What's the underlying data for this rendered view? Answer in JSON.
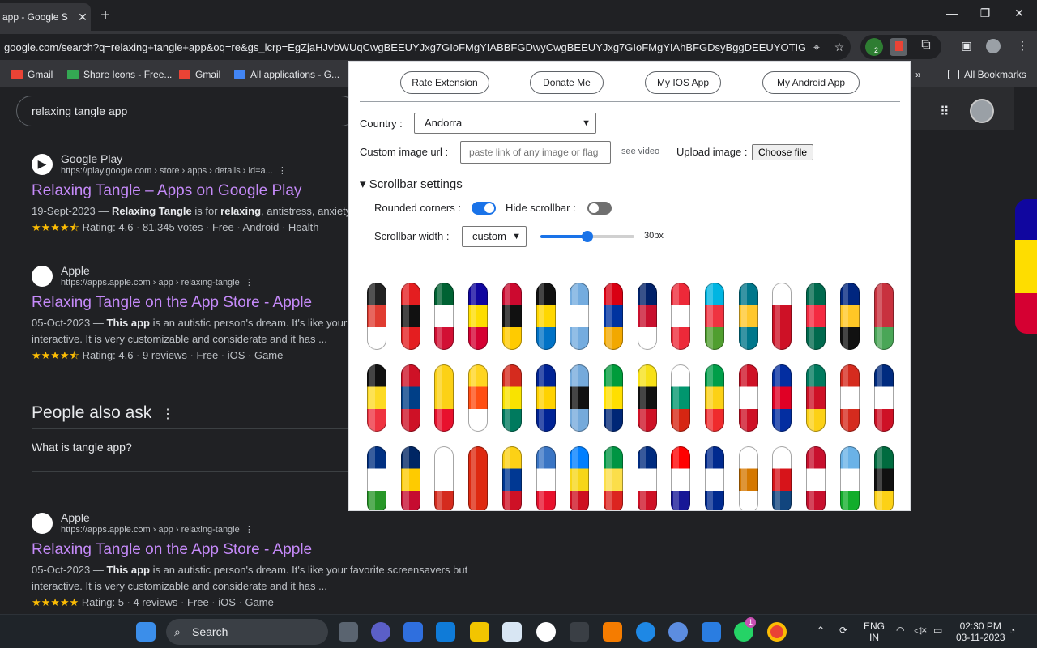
{
  "browser": {
    "tab_title": "app - Google S",
    "tab_close": "✕",
    "new_tab": "+",
    "url": "google.com/search?q=relaxing+tangle+app&oq=re&gs_lcrp=EgZjaHJvbWUqCwgBEEUYJxg7GIoFMgYIABBFGDwyCwgBEEUYJxg7GIoFMgYIAhBFGDsyBggDEEUYOTIGCAQ...",
    "window_controls": [
      "—",
      "❐",
      "✕"
    ],
    "ext_badge": "2",
    "bookmarks": [
      {
        "label": "Gmail",
        "color": "#ea4335"
      },
      {
        "label": "Share Icons - Free...",
        "color": "#34a853"
      },
      {
        "label": "Gmail",
        "color": "#ea4335"
      },
      {
        "label": "All applications - G...",
        "color": "#4285f4"
      }
    ],
    "bookmarks_overflow": "»",
    "all_bookmarks": "All Bookmarks"
  },
  "google": {
    "query": "relaxing tangle app",
    "results": [
      {
        "site": "Google Play",
        "url": "https://play.google.com › store › apps › details › id=a...",
        "title": "Relaxing Tangle – Apps on Google Play",
        "snippet_date": "19-Sept-2023 — ",
        "snippet_b1": "Relaxing Tangle",
        "snippet_mid": " is for ",
        "snippet_b2": "relaxing",
        "snippet_end": ", antistress, anxiety",
        "stars": "★★★★⯪",
        "rating": "Rating: 4.6 · 81,345 votes · Free · Android · Health"
      },
      {
        "site": "Apple",
        "url": "https://apps.apple.com › app › relaxing-tangle",
        "title": "Relaxing Tangle on the App Store - Apple",
        "snippet_date": "05-Oct-2023 — ",
        "snippet_b1": "This app",
        "snippet_mid": " is an autistic person's dream. It's like your",
        "line2": "interactive. It is very customizable and considerate and it has ...",
        "stars": "★★★★⯪",
        "rating": "Rating: 4.6 · 9 reviews · Free · iOS · Game"
      },
      {
        "site": "Apple",
        "url": "https://apps.apple.com › app › relaxing-tangle",
        "title": "Relaxing Tangle on the App Store - Apple",
        "snippet_date": "05-Oct-2023 — ",
        "snippet_b1": "This app",
        "snippet_mid": " is an autistic person's dream. It's like your favorite screensavers but",
        "line2": "interactive. It is very customizable and considerate and it has ...",
        "stars": "★★★★★",
        "rating": "Rating: 5 · 4 reviews · Free · iOS · Game"
      }
    ],
    "people_also_ask": "People also ask",
    "paa_question": "What is tangle app?"
  },
  "popup": {
    "buttons": [
      "Rate Extension",
      "Donate Me",
      "My IOS App",
      "My Android App"
    ],
    "country_label": "Country :",
    "country_value": "Andorra",
    "custom_url_label": "Custom image url :",
    "custom_url_placeholder": "paste link of any image or flag",
    "see_video": "see video",
    "upload_label": "Upload image :",
    "choose_file": "Choose file",
    "scrollbar_settings": "▾ Scrollbar settings",
    "rounded_corners_label": "Rounded corners :",
    "rounded_corners_on": true,
    "hide_scrollbar_label": "Hide scrollbar :",
    "hide_scrollbar_on": false,
    "width_label": "Scrollbar width :",
    "width_select": "custom",
    "width_value": "30px",
    "width_fraction": 0.5,
    "toggle_on_color": "#1a73e8",
    "toggle_off_color": "#6f6f6f",
    "flags": [
      [
        "#222222",
        "#e03c31",
        "#ffffff"
      ],
      [
        "#e41e20",
        "#111111",
        "#e41e20"
      ],
      [
        "#006233",
        "#ffffff",
        "#d21034"
      ],
      [
        "#10069f",
        "#fedd00",
        "#d50032"
      ],
      [
        "#cc092f",
        "#111111",
        "#ffcb00"
      ],
      [
        "#111111",
        "#ffd700",
        "#0072c6"
      ],
      [
        "#74acdf",
        "#ffffff",
        "#74acdf"
      ],
      [
        "#d90012",
        "#0033a0",
        "#f2a800"
      ],
      [
        "#012169",
        "#c8102e",
        "#ffffff"
      ],
      [
        "#ed2939",
        "#ffffff",
        "#ed2939"
      ],
      [
        "#00b5e2",
        "#ef3340",
        "#509e2f"
      ],
      [
        "#00778b",
        "#ffc72c",
        "#00778b"
      ],
      [
        "#ffffff",
        "#ce1126",
        "#ce1126"
      ],
      [
        "#006a4e",
        "#f42a41",
        "#006a4e"
      ],
      [
        "#00267f",
        "#ffc726",
        "#111111"
      ],
      [
        "#c8313e",
        "#c8313e",
        "#4aa657"
      ],
      [
        "#111111",
        "#fdda24",
        "#ef3340"
      ],
      [
        "#ce1126",
        "#003f87",
        "#ce1126"
      ],
      [
        "#fcd116",
        "#fcd116",
        "#e8112d"
      ],
      [
        "#ffd520",
        "#ff4e12",
        "#ffffff"
      ],
      [
        "#d52b1e",
        "#f9e300",
        "#007a5e"
      ],
      [
        "#002395",
        "#ffd200",
        "#002395"
      ],
      [
        "#75aadb",
        "#111111",
        "#75aadb"
      ],
      [
        "#009c3b",
        "#ffdf00",
        "#002776"
      ],
      [
        "#f7e017",
        "#111111",
        "#ce1126"
      ],
      [
        "#ffffff",
        "#00966e",
        "#d62612"
      ],
      [
        "#009e49",
        "#fcd116",
        "#ef2b2d"
      ],
      [
        "#ce1126",
        "#ffffff",
        "#ce1126"
      ],
      [
        "#032ea1",
        "#e00025",
        "#032ea1"
      ],
      [
        "#007a5e",
        "#ce1126",
        "#fcd116"
      ],
      [
        "#d52b1e",
        "#ffffff",
        "#d52b1e"
      ],
      [
        "#002b7f",
        "#ffffff",
        "#ce1126"
      ],
      [
        "#003082",
        "#ffffff",
        "#289728"
      ],
      [
        "#002664",
        "#fecb00",
        "#c60c30"
      ],
      [
        "#ffffff",
        "#ffffff",
        "#d52b1e"
      ],
      [
        "#de2910",
        "#de2910",
        "#de2910"
      ],
      [
        "#fcd116",
        "#003893",
        "#ce1126"
      ],
      [
        "#3a75c4",
        "#ffffff",
        "#e8112d"
      ],
      [
        "#007fff",
        "#f7d618",
        "#ce1021"
      ],
      [
        "#009543",
        "#fbde4a",
        "#dc241f"
      ],
      [
        "#002b7f",
        "#ffffff",
        "#ce1126"
      ],
      [
        "#ff0000",
        "#ffffff",
        "#171796"
      ],
      [
        "#002a8f",
        "#ffffff",
        "#002a8f"
      ],
      [
        "#ffffff",
        "#d57800",
        "#ffffff"
      ],
      [
        "#ffffff",
        "#d7141a",
        "#11457e"
      ],
      [
        "#c8102e",
        "#ffffff",
        "#c8102e"
      ],
      [
        "#6ab2e7",
        "#ffffff",
        "#12ad2b"
      ],
      [
        "#006b3f",
        "#111111",
        "#fcd116"
      ]
    ]
  },
  "side_flag": [
    "#10069f",
    "#fedd00",
    "#d50032"
  ],
  "taskbar": {
    "search": "Search",
    "lang_1": "ENG",
    "lang_2": "IN",
    "time": "02:30 PM",
    "date": "03-11-2023",
    "whatsapp_badge": "1"
  }
}
